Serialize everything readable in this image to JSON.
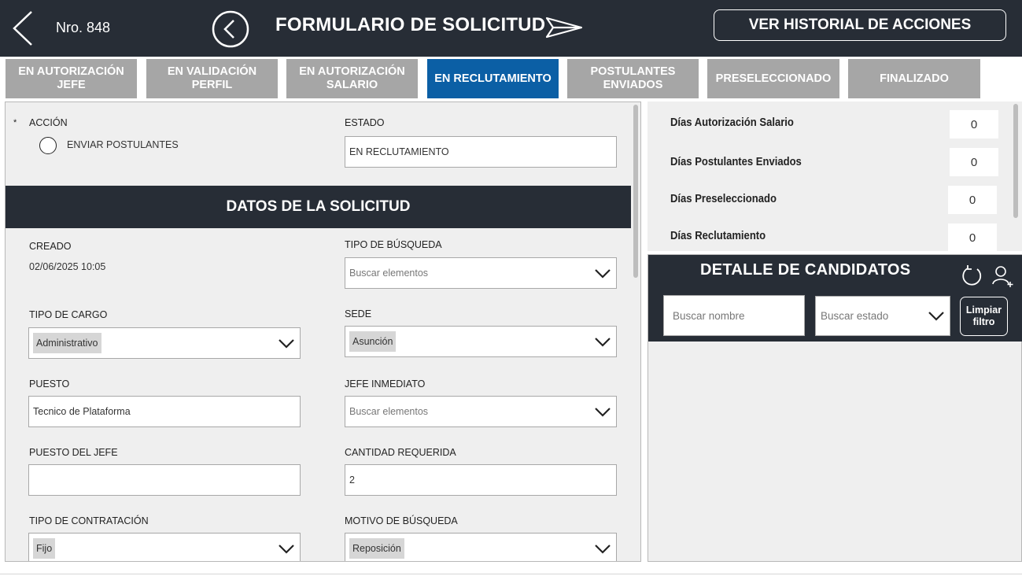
{
  "header": {
    "record_number": "Nro. 848",
    "title": "FORMULARIO DE SOLICITUD",
    "history_button": "VER HISTORIAL DE ACCIONES"
  },
  "tabs": [
    {
      "label": "EN AUTORIZACIÓN JEFE",
      "active": false
    },
    {
      "label": "EN VALIDACIÓN PERFIL",
      "active": false
    },
    {
      "label": "EN AUTORIZACIÓN SALARIO",
      "active": false
    },
    {
      "label": "EN RECLUTAMIENTO",
      "active": true
    },
    {
      "label": "POSTULANTES ENVIADOS",
      "active": false
    },
    {
      "label": "PRESELECCIONADO",
      "active": false
    },
    {
      "label": "FINALIZADO",
      "active": false
    }
  ],
  "form": {
    "required_mark": "*",
    "accion_label": "ACCIÓN",
    "accion_option": "ENVIAR POSTULANTES",
    "estado_label": "ESTADO",
    "estado_value": "EN RECLUTAMIENTO",
    "section_title": "DATOS DE LA SOLICITUD",
    "creado_label": "CREADO",
    "creado_value": "02/06/2025 10:05",
    "tipo_busqueda_label": "TIPO DE BÚSQUEDA",
    "tipo_busqueda_placeholder": "Buscar elementos",
    "tipo_cargo_label": "TIPO DE CARGO",
    "tipo_cargo_value": "Administrativo",
    "sede_label": "SEDE",
    "sede_value": "Asunción",
    "puesto_label": "PUESTO",
    "puesto_value": "Tecnico de Plataforma",
    "jefe_inmediato_label": "JEFE INMEDIATO",
    "jefe_inmediato_placeholder": "Buscar elementos",
    "puesto_jefe_label": "PUESTO DEL JEFE",
    "puesto_jefe_value": "",
    "cantidad_label": "CANTIDAD REQUERIDA",
    "cantidad_value": "2",
    "tipo_contratacion_label": "TIPO DE CONTRATACIÓN",
    "tipo_contratacion_value": "Fijo",
    "motivo_label": "MOTIVO DE BÚSQUEDA",
    "motivo_value": "Reposición"
  },
  "days": [
    {
      "label": "Días Autorización Salario",
      "value": "0"
    },
    {
      "label": "Días Postulantes Enviados",
      "value": "0"
    },
    {
      "label": "Días Preseleccionado",
      "value": "0"
    },
    {
      "label": "Días Reclutamiento",
      "value": "0"
    }
  ],
  "candidates": {
    "title": "DETALLE DE CANDIDATOS",
    "search_name_placeholder": "Buscar nombre",
    "search_state_placeholder": "Buscar estado",
    "clear_filter": "Limpiar filtro"
  },
  "colors": {
    "header_bg": "#272d36",
    "active_tab": "#0b5fa5",
    "inactive_tab": "#a6a6a6",
    "panel_bg": "#efefef"
  }
}
